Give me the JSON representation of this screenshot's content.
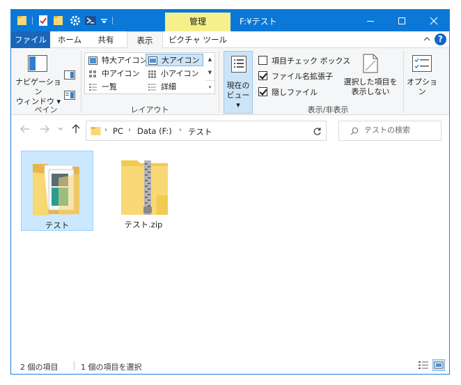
{
  "window": {
    "title": "F:¥テスト",
    "contextual_tab": "管理",
    "controls": {
      "minimize": "—",
      "maximize": "☐",
      "close": "✕"
    }
  },
  "tabs": {
    "file": "ファイル",
    "home": "ホーム",
    "share": "共有",
    "view": "表示",
    "picture_tools": "ピクチャ ツール"
  },
  "ribbon": {
    "panes": {
      "nav_pane_label_1": "ナビゲーション",
      "nav_pane_label_2": "ウィンドウ",
      "group": "ペイン"
    },
    "layout": {
      "items": [
        "特大アイコン",
        "大アイコン",
        "中アイコン",
        "小アイコン",
        "一覧",
        "詳細"
      ],
      "selected": "大アイコン",
      "group": "レイアウト"
    },
    "current_view": {
      "label_1": "現在の",
      "label_2": "ビュー"
    },
    "show_hide": {
      "item_checkboxes": "項目チェック ボックス",
      "item_checkboxes_checked": false,
      "file_extensions": "ファイル名拡張子",
      "file_extensions_checked": true,
      "hidden_items": "隠しファイル",
      "hidden_items_checked": true,
      "hide_selected_1": "選択した項目を",
      "hide_selected_2": "表示しない",
      "group": "表示/非表示"
    },
    "options": "オプション"
  },
  "address": {
    "crumbs": [
      "PC",
      "Data (F:)",
      "テスト"
    ]
  },
  "search": {
    "placeholder": "テストの検索"
  },
  "files": [
    {
      "name": "テスト",
      "type": "folder",
      "selected": true
    },
    {
      "name": "テスト.zip",
      "type": "zip",
      "selected": false
    }
  ],
  "status": {
    "count": "2 個の項目",
    "selection": "1 個の項目を選択"
  },
  "colors": {
    "titlebar": "#0b78d8",
    "contextual_tab": "#f5f08c",
    "file_tab": "#1a66b8",
    "selection": "#cce8ff",
    "folder": "#f8d775"
  }
}
